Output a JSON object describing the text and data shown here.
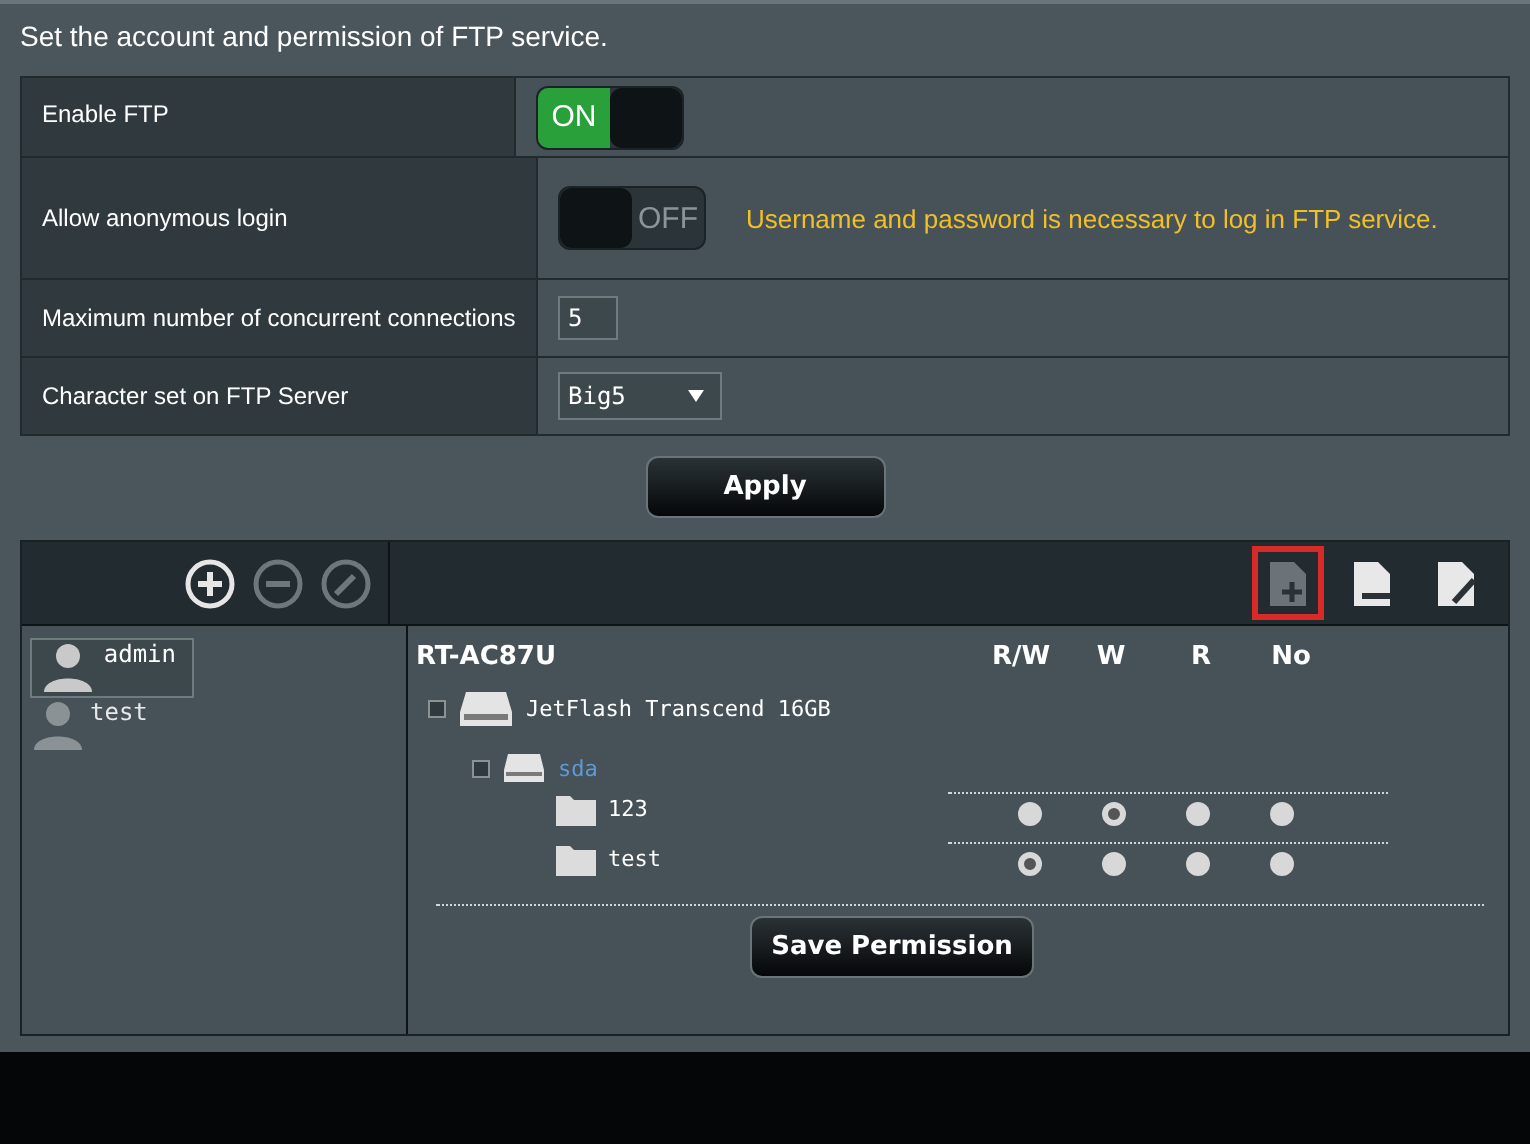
{
  "intro": "Set the account and permission of FTP service.",
  "settings": [
    {
      "kind": "toggle",
      "label": "Enable FTP",
      "on": true,
      "text": "ON"
    },
    {
      "kind": "toggle",
      "label": "Allow anonymous login",
      "on": false,
      "text": "OFF",
      "note": "Username and password is necessary to log in FTP service."
    },
    {
      "kind": "input",
      "label": "Maximum number of concurrent connections",
      "value": "5"
    },
    {
      "kind": "select",
      "label": "Character set on FTP Server",
      "value": "Big5"
    }
  ],
  "apply_button": "Apply",
  "account_tools": [
    {
      "kind": "add",
      "disabled": false
    },
    {
      "kind": "remove",
      "disabled": true
    },
    {
      "kind": "edit",
      "disabled": true
    }
  ],
  "folder_tools": [
    {
      "kind": "new-folder",
      "highlighted": true
    },
    {
      "kind": "delete-folder",
      "highlighted": false
    },
    {
      "kind": "rename-folder",
      "highlighted": false
    }
  ],
  "accounts": [
    {
      "name": "admin",
      "selected": true
    },
    {
      "name": "test",
      "selected": false
    }
  ],
  "router": "RT-AC87U",
  "permission_columns": [
    "R/W",
    "W",
    "R",
    "No"
  ],
  "disk": "JetFlash Transcend 16GB",
  "partition": "sda",
  "folders": [
    {
      "name": "123",
      "permissions": [
        {
          "selected": false
        },
        {
          "selected": true
        },
        {
          "selected": false
        },
        {
          "selected": false
        }
      ]
    },
    {
      "name": "test",
      "permissions": [
        {
          "selected": true
        },
        {
          "selected": false
        },
        {
          "selected": false
        },
        {
          "selected": false
        }
      ]
    }
  ],
  "save_button": "Save Permission"
}
